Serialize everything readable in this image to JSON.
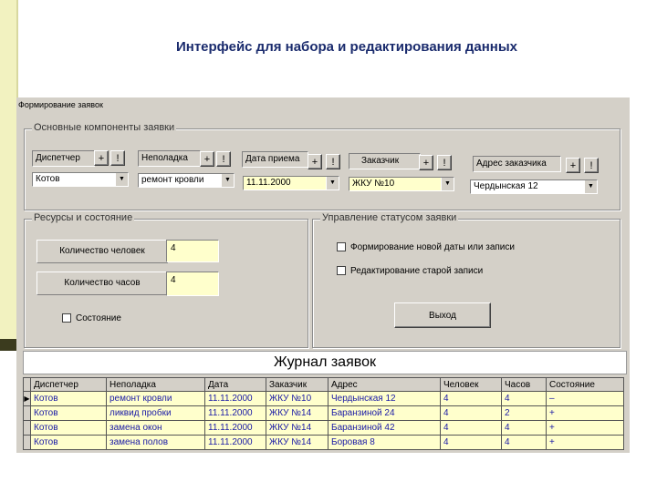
{
  "slide": {
    "title": "Интерфейс для набора и редактирования данных"
  },
  "window": {
    "title": "Формирование заявок"
  },
  "groups": {
    "main": "Основные компоненты заявки",
    "resources": "Ресурсы и состояние",
    "status": "Управление статусом заявки"
  },
  "fields": {
    "dispatcher": {
      "label": "Диспетчер",
      "value": "Котов"
    },
    "fault": {
      "label": "Неполадка",
      "value": "ремонт кровли"
    },
    "date": {
      "label": "Дата приема",
      "value": "11.11.2000"
    },
    "customer": {
      "label": "Заказчик",
      "value": "ЖКУ №10"
    },
    "address": {
      "label": "Адрес заказчика",
      "value": "Чердынская 12"
    }
  },
  "buttons": {
    "add": "+",
    "edit": "!",
    "exit": "Выход"
  },
  "resources": {
    "people_label": "Количество человек",
    "people_value": "4",
    "hours_label": "Количество часов",
    "hours_value": "4",
    "state_label": "Состояние"
  },
  "status": {
    "new_date": "Формирование новой даты или записи",
    "edit_old": "Редактирование старой записи"
  },
  "journal": {
    "title": "Журнал заявок",
    "columns": [
      "Диспетчер",
      "Неполадка",
      "Дата",
      "Заказчик",
      "Адрес",
      "Человек",
      "Часов",
      "Состояние"
    ],
    "rows": [
      [
        "Котов",
        "ремонт кровли",
        "11.11.2000",
        "ЖКУ №10",
        "Чердынская 12",
        "4",
        "4",
        "–"
      ],
      [
        "Котов",
        "ликвид пробки",
        "11.11.2000",
        "ЖКУ №14",
        "Баранзиной 24",
        "4",
        "2",
        "+"
      ],
      [
        "Котов",
        "замена окон",
        "11.11.2000",
        "ЖКУ №14",
        "Баранзиной 42",
        "4",
        "4",
        "+"
      ],
      [
        "Котов",
        "замена полов",
        "11.11.2000",
        "ЖКУ №14",
        "Боровая 8",
        "4",
        "4",
        "+"
      ]
    ],
    "current_indicator": "▶"
  }
}
